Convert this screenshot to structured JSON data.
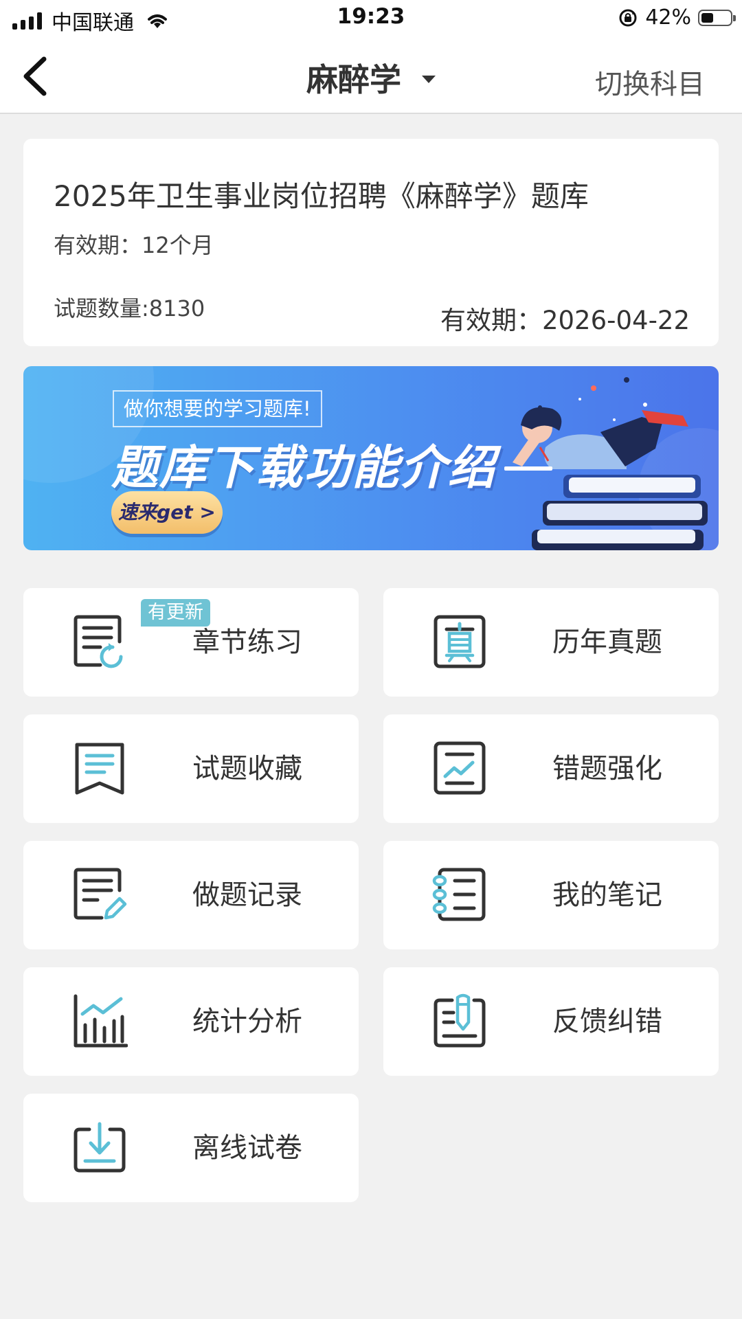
{
  "status_bar": {
    "carrier": "中国联通",
    "time": "19:23",
    "battery": "42%",
    "battery_level": 0.42
  },
  "nav": {
    "title": "麻醉学",
    "switch_label": "切换科目"
  },
  "info": {
    "title": "2025年卫生事业岗位招聘《麻醉学》题库",
    "validity": "有效期：12个月",
    "question_count": "试题数量:8130",
    "expiry": "有效期：2026-04-22"
  },
  "banner": {
    "subtitle": "做你想要的学习题库!",
    "headline": "题库下载功能介绍",
    "cta": "速来get >"
  },
  "menu": {
    "items": [
      {
        "label": "章节练习",
        "icon": "chapter-practice-icon",
        "badge": "有更新"
      },
      {
        "label": "历年真题",
        "icon": "past-exams-icon"
      },
      {
        "label": "试题收藏",
        "icon": "bookmark-icon"
      },
      {
        "label": "错题强化",
        "icon": "trend-chart-icon"
      },
      {
        "label": "做题记录",
        "icon": "edit-document-icon"
      },
      {
        "label": "我的笔记",
        "icon": "notebook-icon"
      },
      {
        "label": "统计分析",
        "icon": "bar-chart-icon"
      },
      {
        "label": "反馈纠错",
        "icon": "feedback-pen-icon"
      },
      {
        "label": "离线试卷",
        "icon": "download-icon"
      }
    ]
  },
  "colors": {
    "accent": "#5bbfd6",
    "icon_dark": "#333333",
    "background": "#f1f1f1",
    "badge": "#6fc3d4"
  }
}
